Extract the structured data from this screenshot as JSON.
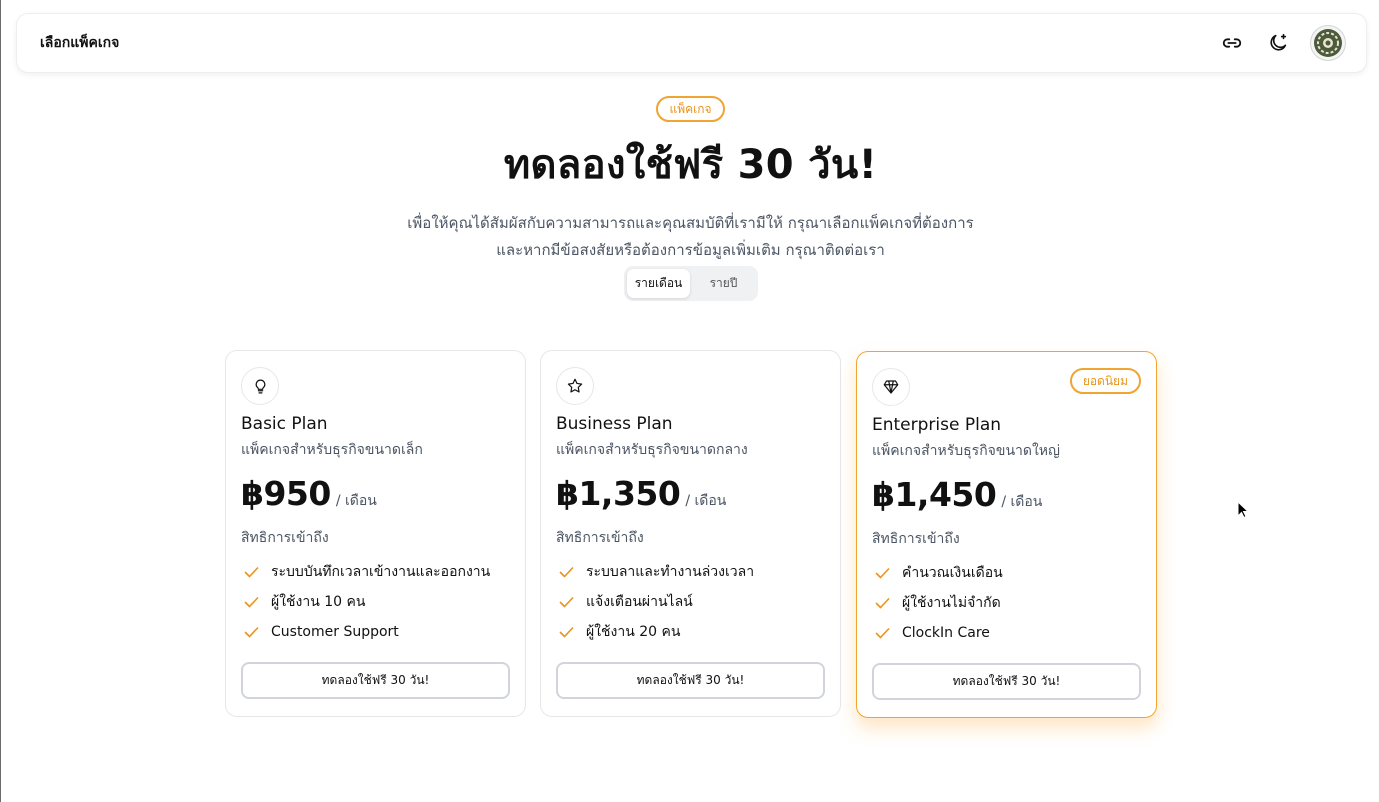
{
  "header": {
    "title": "เลือกแพ็คเกจ",
    "link_icon": "link-icon",
    "theme_icon": "moon-star-icon",
    "avatar_icon": "avatar-logo"
  },
  "hero": {
    "pill": "แพ็คเกจ",
    "title": "ทดลองใช้ฟรี 30 วัน!",
    "subtitle_line1": "เพื่อให้คุณได้สัมผัสกับความสามารถและคุณสมบัติที่เรามีให้ กรุณาเลือกแพ็คเกจที่ต้องการ",
    "subtitle_line2": "และหากมีข้อสงสัยหรือต้องการข้อมูลเพิ่มเติม กรุณาติดต่อเรา"
  },
  "billing_toggle": {
    "monthly": "รายเดือน",
    "yearly": "รายปี",
    "selected": "monthly"
  },
  "plans": [
    {
      "icon": "lightbulb-icon",
      "name": "Basic Plan",
      "description": "แพ็คเกจสำหรับธุรกิจขนาดเล็ก",
      "price": "฿950",
      "period": "/ เดือน",
      "access_label": "สิทธิการเข้าถึง",
      "features": [
        "ระบบบันทึกเวลาเข้างานและออกงาน",
        "ผู้ใช้งาน 10 คน",
        "Customer Support"
      ],
      "cta": "ทดลองใช้ฟรี 30 วัน!"
    },
    {
      "icon": "star-icon",
      "name": "Business Plan",
      "description": "แพ็คเกจสำหรับธุรกิจขนาดกลาง",
      "price": "฿1,350",
      "period": "/ เดือน",
      "access_label": "สิทธิการเข้าถึง",
      "features": [
        "ระบบลาและทำงานล่วงเวลา",
        "แจ้งเตือนผ่านไลน์",
        "ผู้ใช้งาน 20 คน"
      ],
      "cta": "ทดลองใช้ฟรี 30 วัน!"
    },
    {
      "icon": "diamond-icon",
      "badge": "ยอดนิยม",
      "name": "Enterprise Plan",
      "description": "แพ็คเกจสำหรับธุรกิจขนาดใหญ่",
      "price": "฿1,450",
      "period": "/ เดือน",
      "access_label": "สิทธิการเข้าถึง",
      "features": [
        "คำนวณเงินเดือน",
        "ผู้ใช้งานไม่จำกัด",
        "ClockIn Care"
      ],
      "cta": "ทดลองใช้ฟรี 30 วัน!"
    }
  ],
  "colors": {
    "accent": "#f0a431",
    "check": "#e8941c",
    "text": "#111827",
    "muted": "#4b5563"
  }
}
